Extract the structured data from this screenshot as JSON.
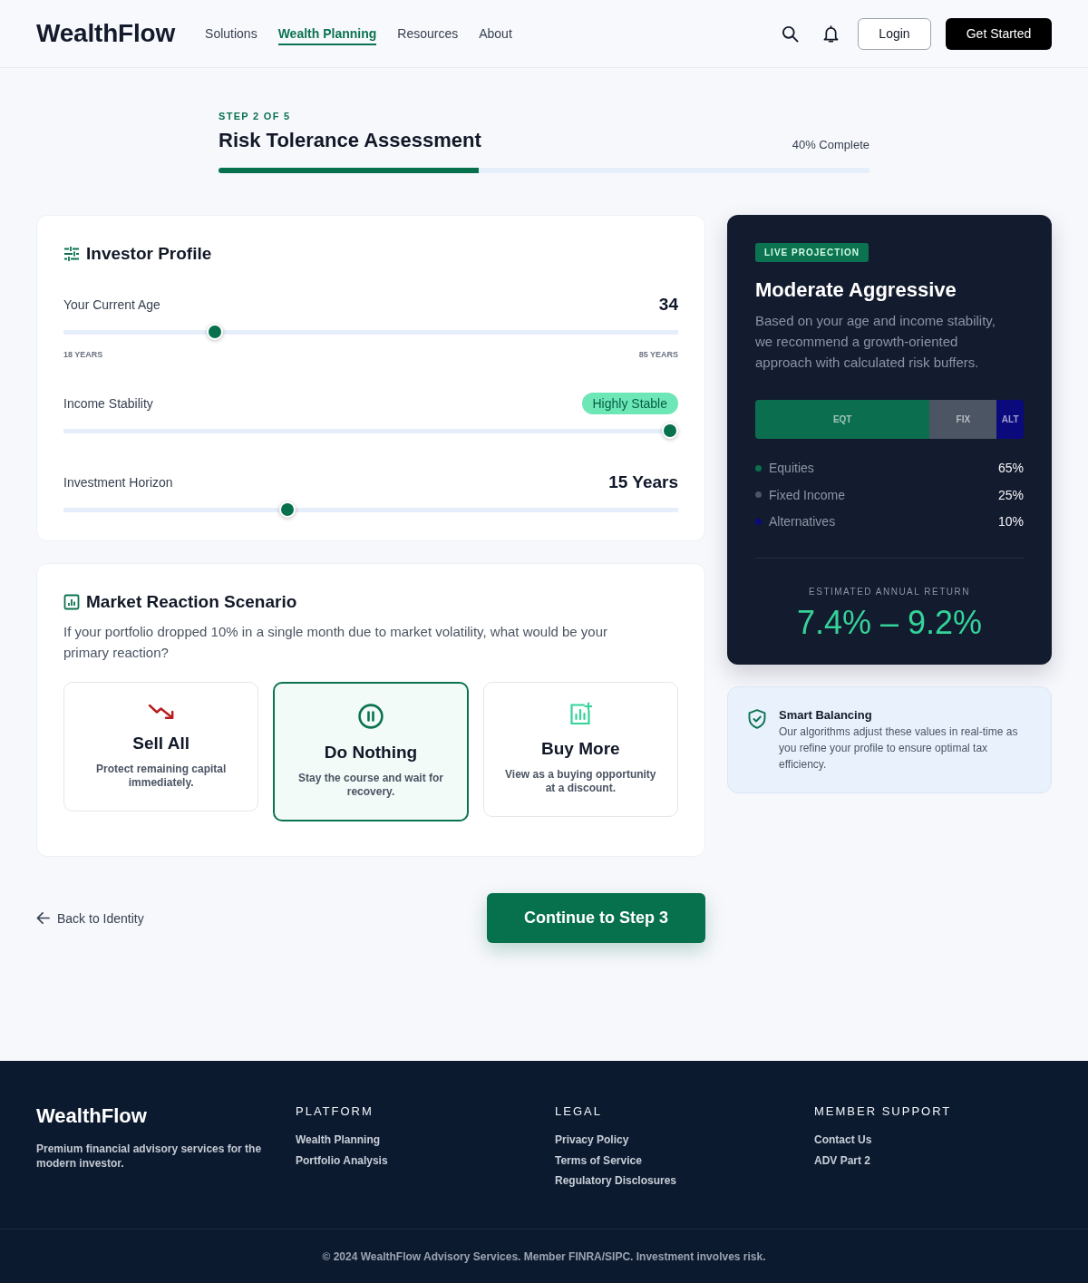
{
  "header": {
    "logo": "WealthFlow",
    "nav": [
      {
        "label": "Solutions",
        "selected": false
      },
      {
        "label": "Wealth Planning",
        "selected": true
      },
      {
        "label": "Resources",
        "selected": false
      },
      {
        "label": "About",
        "selected": false
      }
    ],
    "login": "Login",
    "cta": "Get Started"
  },
  "progress": {
    "step": "STEP 2 OF 5",
    "title": "Risk Tolerance Assessment",
    "status": "40% Complete",
    "level": 0.4
  },
  "investor_profile": {
    "title": "Investor Profile",
    "fields": [
      {
        "kind": "number",
        "label": "Your Current Age",
        "value": "34",
        "level": 0.24,
        "min_label": "18 YEARS",
        "max_label": "85 YEARS"
      },
      {
        "kind": "badge",
        "label": "Income Stability",
        "value": "Highly Stable",
        "level": 1
      },
      {
        "kind": "number",
        "label": "Investment Horizon",
        "value": "15 Years",
        "level": 0.36
      }
    ]
  },
  "market_reaction": {
    "title": "Market Reaction Scenario",
    "question": "If your portfolio dropped 10% in a single month due to market volatility, what would be your primary reaction?",
    "options": [
      {
        "kind": "sell",
        "title": "Sell All",
        "description": "Protect remaining capital immediately.",
        "selected": false
      },
      {
        "kind": "hold",
        "title": "Do Nothing",
        "description": "Stay the course and wait for recovery.",
        "selected": true
      },
      {
        "kind": "buy",
        "title": "Buy More",
        "description": "View as a buying opportunity at a discount.",
        "selected": false
      }
    ]
  },
  "actions": {
    "back": "Back to Identity",
    "continue": "Continue to Step 3"
  },
  "projection": {
    "badge": "LIVE PROJECTION",
    "title": "Moderate Aggressive",
    "description": "Based on your age and income stability, we recommend a growth-oriented approach with calculated risk buffers.",
    "allocation": [
      {
        "code": "EQT",
        "name": "Equities",
        "share": "65%",
        "color": "#0b6e4f"
      },
      {
        "code": "FIX",
        "name": "Fixed Income",
        "share": "25%",
        "color": "#4b5563"
      },
      {
        "code": "ALT",
        "name": "Alternatives",
        "share": "10%",
        "color": "#0a0a7d"
      }
    ],
    "return_label": "ESTIMATED ANNUAL RETURN",
    "return_value": "7.4% – 9.2%"
  },
  "smart_balancing": {
    "title": "Smart Balancing",
    "text": "Our algorithms adjust these values in real-time as you refine your profile to ensure optimal tax efficiency."
  },
  "footer": {
    "brand": "WealthFlow",
    "tagline": "Premium financial advisory services for the modern investor.",
    "columns": [
      {
        "heading": "PLATFORM",
        "links": [
          "Wealth Planning",
          "Portfolio Analysis"
        ]
      },
      {
        "heading": "LEGAL",
        "links": [
          "Privacy Policy",
          "Terms of Service",
          "Regulatory Disclosures"
        ]
      },
      {
        "heading": "MEMBER SUPPORT",
        "links": [
          "Contact Us",
          "ADV Part 2"
        ]
      }
    ],
    "copyright": "© 2024 WealthFlow Advisory Services. Member FINRA/SIPC. Investment involves risk."
  }
}
